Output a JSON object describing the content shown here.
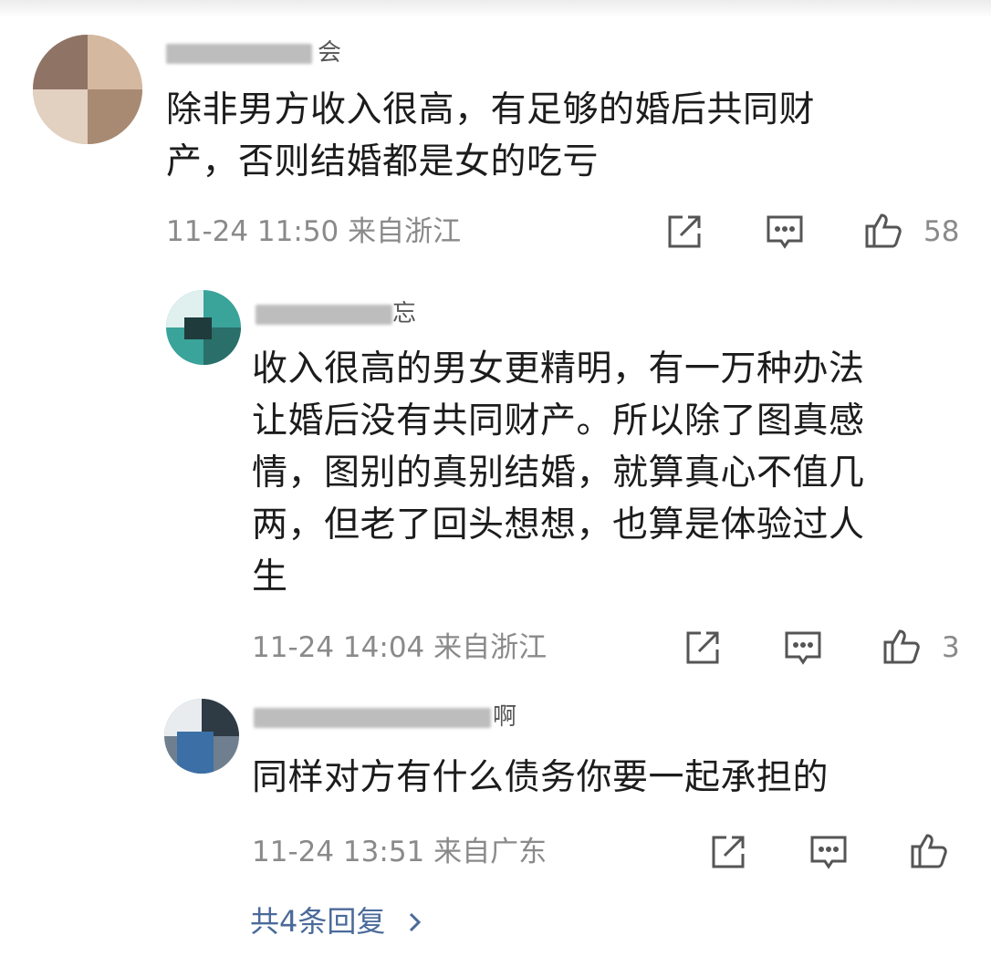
{
  "comments": [
    {
      "username_visible": "会",
      "text_line1": "除非男方收入很高，有足够的婚后共同财",
      "text_line2": "产，否则结婚都是女的吃亏",
      "timestamp": "11-24 11:50 来自浙江",
      "likes": "58"
    },
    {
      "username_visible": "忘",
      "text_line1": "收入很高的男女更精明，有一万种办法",
      "text_line2": "让婚后没有共同财产。所以除了图真感",
      "text_line3": "情，图别的真别结婚，就算真心不值几",
      "text_line4": "两，但老了回头想想，也算是体验过人",
      "text_line5": "生",
      "timestamp": "11-24 14:04 来自浙江",
      "likes": "3"
    },
    {
      "username_visible": "啊",
      "text_line1": "同样对方有什么债务你要一起承担的",
      "timestamp": "11-24 13:51 来自广东",
      "likes": ""
    }
  ],
  "replies_link": "共4条回复",
  "icons": {
    "share": "share-icon",
    "comment": "comment-icon",
    "like": "like-icon",
    "more": "chevron-right-icon"
  },
  "colors": {
    "text": "#1c1c1c",
    "meta": "#8a8a8a",
    "link": "#4a6a9a"
  }
}
